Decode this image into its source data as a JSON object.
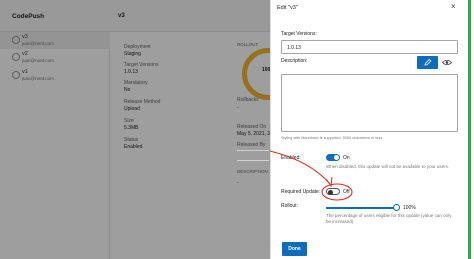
{
  "app": {
    "name": "CodePush",
    "release_title": "v3"
  },
  "releases": [
    {
      "name": "v3",
      "user": "juan@nerd.com"
    },
    {
      "name": "v2",
      "user": "juan@nerd.com"
    },
    {
      "name": "v1",
      "user": "juan@nerd.com"
    }
  ],
  "details": {
    "deployment_label": "Deployment",
    "deployment": "Staging",
    "target_label": "Target Versions",
    "target": "1.0.13",
    "mandatory_label": "Mandatory",
    "mandatory": "No",
    "method_label": "Release Method",
    "method": "Upload",
    "size_label": "Size",
    "size": "5.3MB",
    "status_label": "Status",
    "status": "Enabled",
    "rollout_label": "ROLLOUT",
    "rollout_value": "100",
    "rollbacks_label": "Rollbacks",
    "rollbacks": "-",
    "released_on_label": "Released On",
    "released_on": "May 5, 2021, 3:",
    "released_by_label": "Released By",
    "description_label": "DESCRIPTION",
    "description": "-"
  },
  "panel": {
    "title": "Edit \"v3\"",
    "target_versions_label": "Target Versions:",
    "target_versions_value": "1.0.13",
    "description_label": "Description:",
    "description_value": "",
    "markdown_hint": "Styling with Markdown is supported. 5000 characters or less.",
    "enabled_label": "Enabled:",
    "enabled_state": "On",
    "enabled_help": "When disabled, this update will not be available to your users.",
    "required_label": "Required Update:",
    "required_state": "Off",
    "rollout_label": "Rollout:",
    "rollout_value": "100%",
    "rollout_fraction": 1.0,
    "rollout_help": "The percentage of users eligible for this update (value can only be increased).",
    "done_label": "Done"
  },
  "colors": {
    "accent": "#0f6cbd",
    "annotation": "#e02b1f",
    "ring": "#f2b632",
    "edge_bar": "#2ca94a"
  },
  "icons": {
    "close": "close-icon",
    "edit": "pencil-icon",
    "preview": "eye-icon",
    "user": "user-icon"
  }
}
